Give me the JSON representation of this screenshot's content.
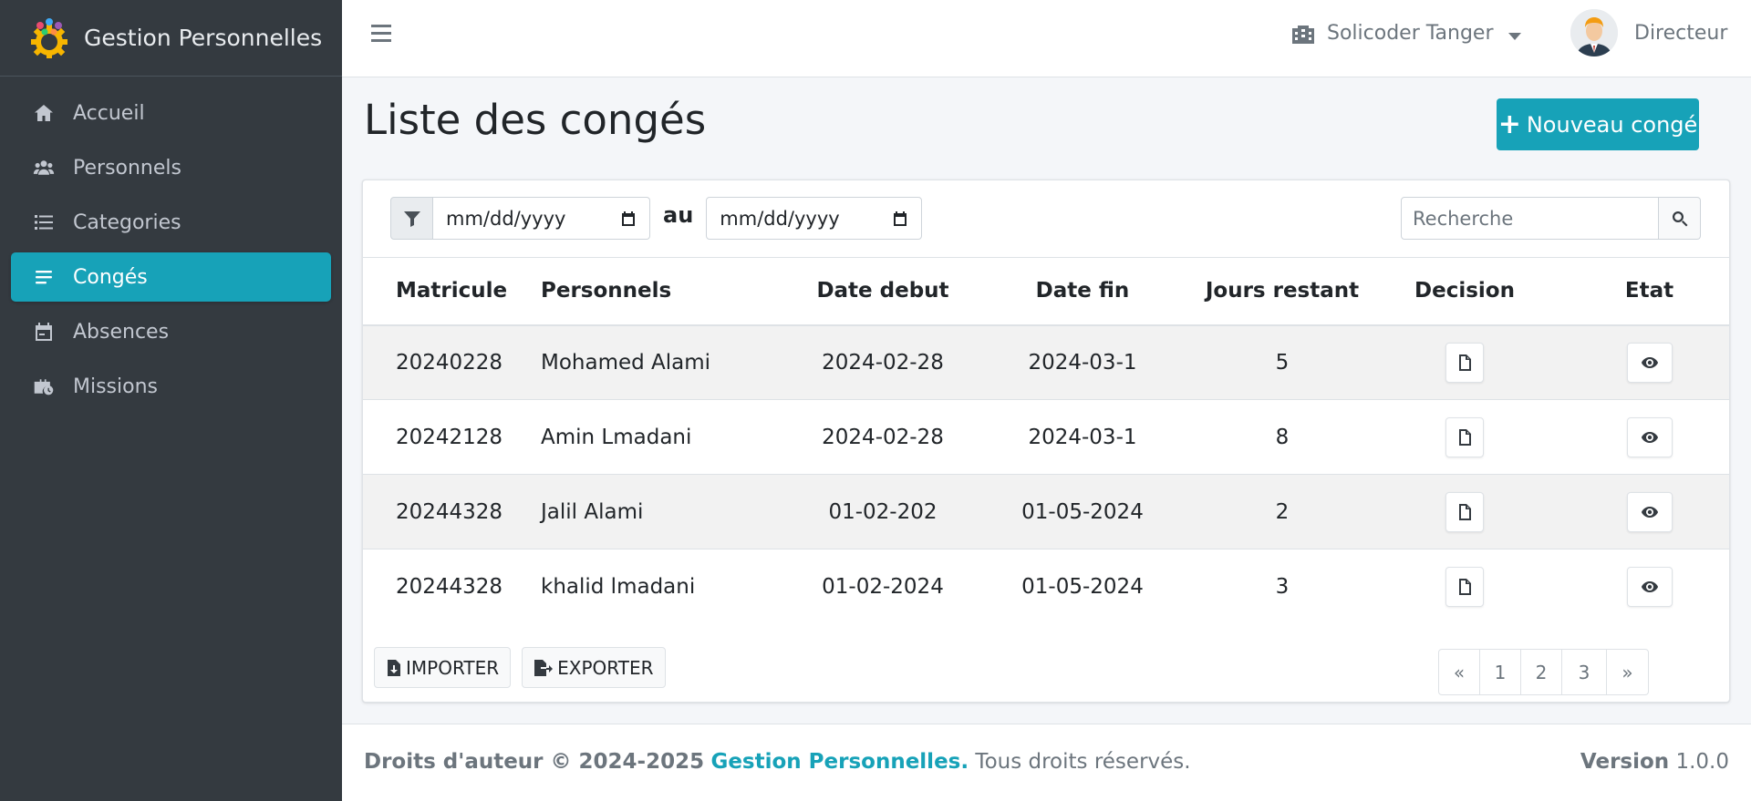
{
  "brand": {
    "name": "Gestion Personnelles"
  },
  "sidebar": {
    "items": [
      {
        "label": "Accueil",
        "icon": "home-icon"
      },
      {
        "label": "Personnels",
        "icon": "users-icon"
      },
      {
        "label": "Categories",
        "icon": "list-icon"
      },
      {
        "label": "Congés",
        "icon": "bars-icon",
        "active": true
      },
      {
        "label": "Absences",
        "icon": "calendar-icon"
      },
      {
        "label": "Missions",
        "icon": "briefcase-clock-icon"
      }
    ]
  },
  "topbar": {
    "company": "Solicoder Tanger",
    "user": "Directeur"
  },
  "main": {
    "title": "Liste des congés",
    "new_button": "Nouveau congé",
    "filter": {
      "date_from_placeholder": "mm/dd/yyyy",
      "separator": "au",
      "date_to_placeholder": "mm/dd/yyyy"
    },
    "search": {
      "placeholder": "Recherche"
    },
    "table": {
      "headers": [
        "Matricule",
        "Personnels",
        "Date debut",
        "Date fin",
        "Jours restant",
        "Decision",
        "Etat"
      ],
      "rows": [
        {
          "matricule": "20240228",
          "personnel": "Mohamed Alami",
          "date_debut": "2024-02-28",
          "date_fin": "2024-03-1",
          "jours": "5"
        },
        {
          "matricule": "20242128",
          "personnel": "Amin Lmadani",
          "date_debut": "2024-02-28",
          "date_fin": "2024-03-1",
          "jours": "8"
        },
        {
          "matricule": "20244328",
          "personnel": "Jalil Alami",
          "date_debut": "01-02-202",
          "date_fin": "01-05-2024",
          "jours": "2"
        },
        {
          "matricule": "20244328",
          "personnel": "khalid lmadani",
          "date_debut": "01-02-2024",
          "date_fin": "01-05-2024",
          "jours": "3"
        }
      ]
    },
    "import_label": "IMPORTER",
    "export_label": "EXPORTER",
    "pagination": {
      "prev": "«",
      "pages": [
        "1",
        "2",
        "3"
      ],
      "next": "»"
    }
  },
  "footer": {
    "copyright_prefix": "Droits d'auteur © 2024-2025",
    "brand": "Gestion Personnelles.",
    "suffix": "Tous droits réservés.",
    "version_label": "Version",
    "version": "1.0.0"
  },
  "colors": {
    "accent": "#17a2b8",
    "sidebar_bg": "#343a40"
  }
}
